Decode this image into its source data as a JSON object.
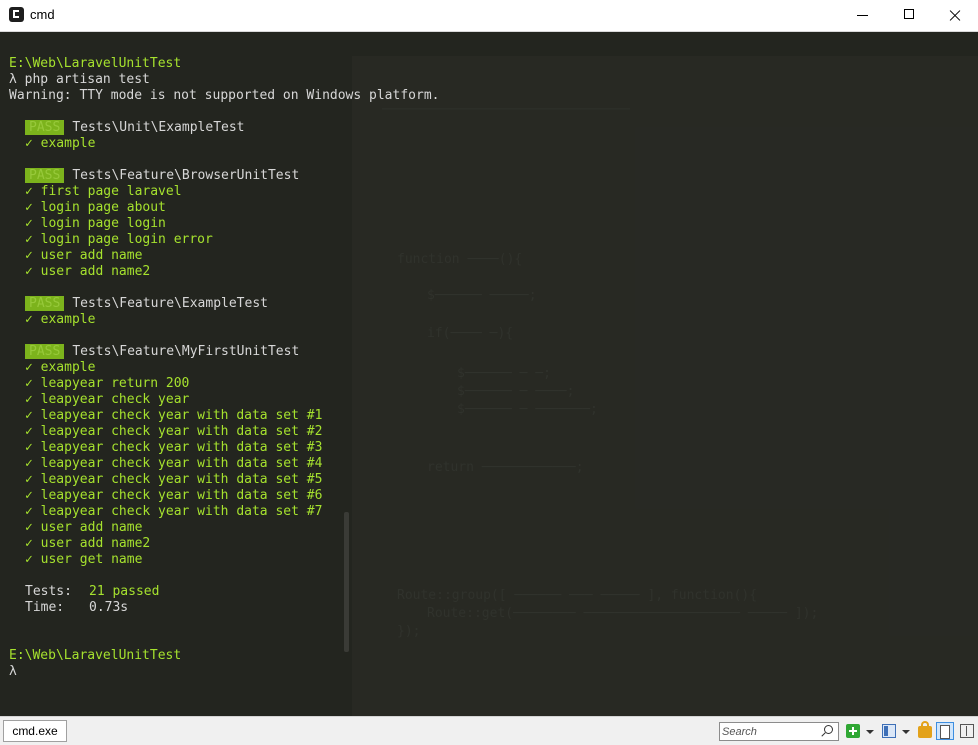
{
  "window": {
    "title": "cmd",
    "icon": "cmder-icon"
  },
  "terminal": {
    "lines": [
      {
        "kind": "path",
        "text": "E:\\Web\\LaravelUnitTest"
      },
      {
        "kind": "text",
        "text": "λ php artisan test"
      },
      {
        "kind": "text",
        "text": "Warning: TTY mode is not supported on Windows platform."
      },
      {
        "kind": "blank"
      },
      {
        "kind": "suite",
        "badge": "PASS",
        "text": "Tests\\Unit\\ExampleTest"
      },
      {
        "kind": "check",
        "text": "✓ example"
      },
      {
        "kind": "blank"
      },
      {
        "kind": "suite",
        "badge": "PASS",
        "text": "Tests\\Feature\\BrowserUnitTest"
      },
      {
        "kind": "check",
        "text": "✓ first page laravel"
      },
      {
        "kind": "check",
        "text": "✓ login page about"
      },
      {
        "kind": "check",
        "text": "✓ login page login"
      },
      {
        "kind": "check",
        "text": "✓ login page login error"
      },
      {
        "kind": "check",
        "text": "✓ user add name"
      },
      {
        "kind": "check",
        "text": "✓ user add name2"
      },
      {
        "kind": "blank"
      },
      {
        "kind": "suite",
        "badge": "PASS",
        "text": "Tests\\Feature\\ExampleTest"
      },
      {
        "kind": "check",
        "text": "✓ example"
      },
      {
        "kind": "blank"
      },
      {
        "kind": "suite",
        "badge": "PASS",
        "text": "Tests\\Feature\\MyFirstUnitTest"
      },
      {
        "kind": "check",
        "text": "✓ example"
      },
      {
        "kind": "check",
        "text": "✓ leapyear return 200"
      },
      {
        "kind": "check",
        "text": "✓ leapyear check year"
      },
      {
        "kind": "check",
        "text": "✓ leapyear check year with data set #1"
      },
      {
        "kind": "check",
        "text": "✓ leapyear check year with data set #2"
      },
      {
        "kind": "check",
        "text": "✓ leapyear check year with data set #3"
      },
      {
        "kind": "check",
        "text": "✓ leapyear check year with data set #4"
      },
      {
        "kind": "check",
        "text": "✓ leapyear check year with data set #5"
      },
      {
        "kind": "check",
        "text": "✓ leapyear check year with data set #6"
      },
      {
        "kind": "check",
        "text": "✓ leapyear check year with data set #7"
      },
      {
        "kind": "check",
        "text": "✓ user add name"
      },
      {
        "kind": "check",
        "text": "✓ user add name2"
      },
      {
        "kind": "check",
        "text": "✓ user get name"
      },
      {
        "kind": "blank"
      },
      {
        "kind": "summary",
        "label": "Tests:",
        "value": "21 passed"
      },
      {
        "kind": "summary2",
        "label": "Time:",
        "value": "0.73s"
      },
      {
        "kind": "blank"
      },
      {
        "kind": "blank"
      },
      {
        "kind": "path",
        "text": "E:\\Web\\LaravelUnitTest"
      },
      {
        "kind": "text",
        "text": "λ"
      }
    ]
  },
  "statusbar": {
    "tab_label": "cmd.exe",
    "search_placeholder": "Search",
    "icons": [
      "search-icon",
      "add-tab-icon",
      "layout-icon",
      "lock-icon",
      "panel-icon",
      "grid-icon"
    ]
  },
  "colors": {
    "background": "#272822",
    "path_green": "#a6e22e",
    "pass_badge": "#7cb31c"
  }
}
